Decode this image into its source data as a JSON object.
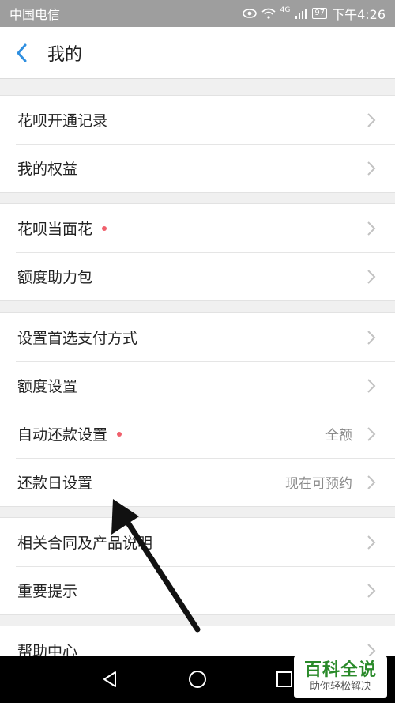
{
  "statusbar": {
    "carrier": "中国电信",
    "network": "4G",
    "battery": "97",
    "time": "下午4:26"
  },
  "nav": {
    "title": "我的"
  },
  "groups": [
    {
      "items": [
        {
          "label": "花呗开通记录"
        },
        {
          "label": "我的权益"
        }
      ]
    },
    {
      "items": [
        {
          "label": "花呗当面花",
          "dot": true
        },
        {
          "label": "额度助力包"
        }
      ]
    },
    {
      "items": [
        {
          "label": "设置首选支付方式"
        },
        {
          "label": "额度设置"
        },
        {
          "label": "自动还款设置",
          "dot": true,
          "value": "全额"
        },
        {
          "label": "还款日设置",
          "value": "现在可预约"
        }
      ]
    },
    {
      "items": [
        {
          "label": "相关合同及产品说明"
        },
        {
          "label": "重要提示"
        }
      ]
    },
    {
      "items": [
        {
          "label": "帮助中心"
        }
      ]
    }
  ],
  "watermark": {
    "line1": "百科全说",
    "line2": "助你轻松解决"
  },
  "colors": {
    "accent": "#2f8fe0",
    "dot": "#f0606c",
    "watermark": "#2a8a2a"
  }
}
